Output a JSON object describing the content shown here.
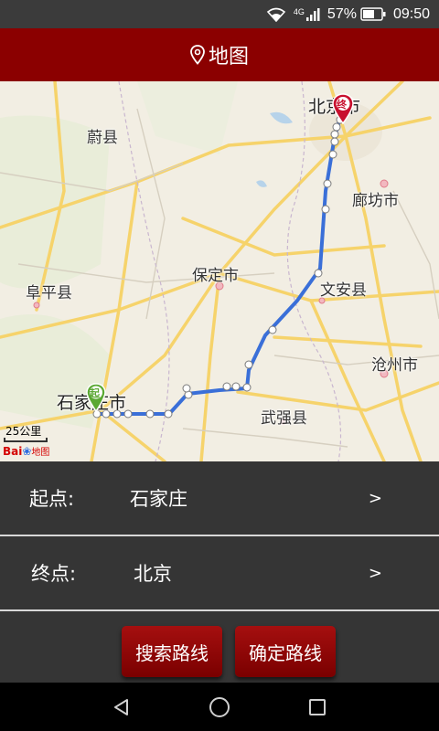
{
  "status_bar": {
    "network": "4G",
    "battery": "57%",
    "time": "09:50"
  },
  "header": {
    "title": "地图",
    "icon": "location-pin-icon"
  },
  "map": {
    "cities": {
      "beijing": "北京市",
      "yuxian": "蔚县",
      "langfang": "廊坊市",
      "baoding": "保定市",
      "wenan": "文安县",
      "fuping": "阜平县",
      "cangzhou": "沧州市",
      "shijiazhuang": "石家庄市",
      "wuqiang": "武强县"
    },
    "start_marker": "起",
    "end_marker": "终",
    "scale": "25公里",
    "logo_text": "Bai",
    "logo_suffix": "地图"
  },
  "route_form": {
    "start_label": "起点:",
    "start_value": "石家庄",
    "end_label": "终点:",
    "end_value": "北京",
    "arrow": ">"
  },
  "actions": {
    "search_label": "搜索路线",
    "confirm_label": "确定路线"
  },
  "colors": {
    "header": "#8b0000",
    "route": "#3a6fd8",
    "start_marker": "#5aa832",
    "end_marker": "#c8102e"
  }
}
